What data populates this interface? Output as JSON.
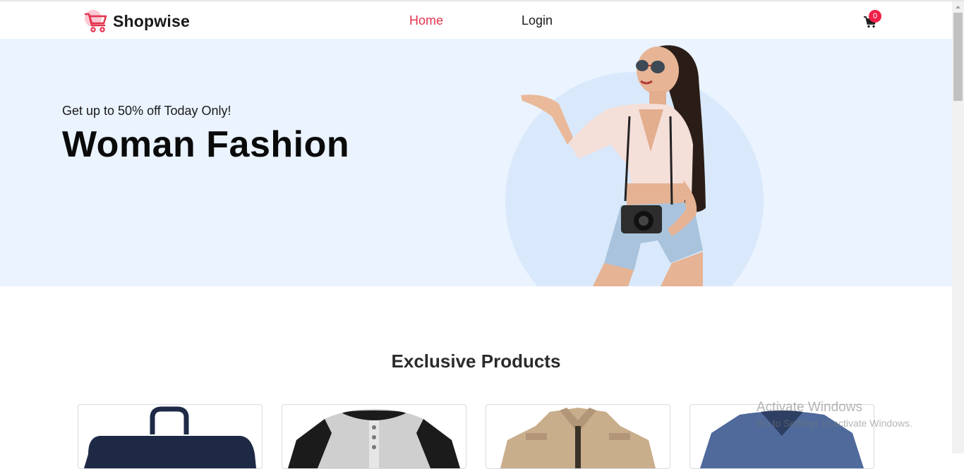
{
  "brand": {
    "name": "Shopwise",
    "logo_icon": "shopping-cart-icon",
    "accent": "#e3344f"
  },
  "nav": {
    "home_label": "Home",
    "login_label": "Login"
  },
  "cart": {
    "icon": "cart-icon",
    "count": "0",
    "badge_color": "#f0224a"
  },
  "hero": {
    "subtitle": "Get up to 50% off Today Only!",
    "title": "Woman Fashion",
    "background": "#eaf3fe"
  },
  "section": {
    "title": "Exclusive Products"
  },
  "products": [
    {
      "image": "navy-tote-bag"
    },
    {
      "image": "raglan-henley-shirt"
    },
    {
      "image": "beige-jacket"
    },
    {
      "image": "blue-v-neck-tshirt"
    }
  ],
  "watermark": {
    "line1": "Activate Windows",
    "line2": "Go to Settings to activate Windows."
  }
}
